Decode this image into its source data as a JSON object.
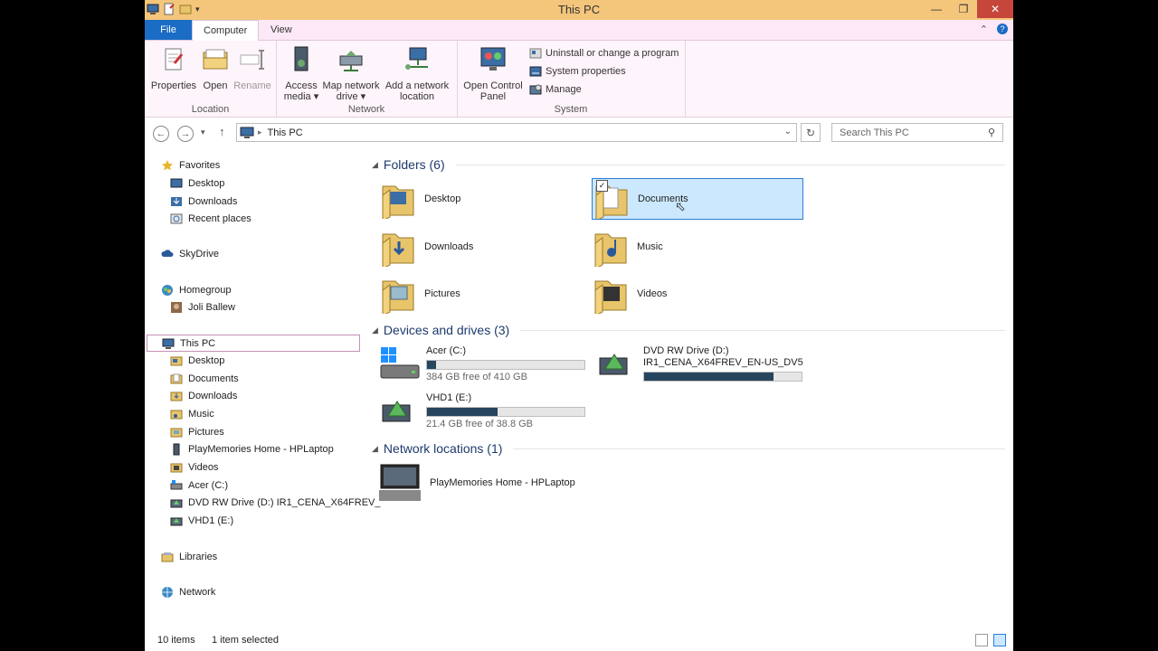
{
  "window": {
    "title": "This PC"
  },
  "ribbon": {
    "tabs": {
      "file": "File",
      "computer": "Computer",
      "view": "View"
    },
    "groups": {
      "location": "Location",
      "network": "Network",
      "system": "System"
    },
    "buttons": {
      "properties": "Properties",
      "open": "Open",
      "rename": "Rename",
      "access_media": "Access media ▾",
      "map_network_drive": "Map network drive ▾",
      "add_network_location": "Add a network location",
      "open_control_panel": "Open Control Panel",
      "uninstall": "Uninstall or change a program",
      "system_properties": "System properties",
      "manage": "Manage"
    }
  },
  "address": {
    "path": "This PC",
    "search_placeholder": "Search This PC"
  },
  "nav": {
    "favorites": "Favorites",
    "desktop": "Desktop",
    "downloads": "Downloads",
    "recent_places": "Recent places",
    "skydrive": "SkyDrive",
    "homegroup": "Homegroup",
    "joli_ballew": "Joli Ballew",
    "this_pc": "This PC",
    "pc_desktop": "Desktop",
    "pc_documents": "Documents",
    "pc_downloads": "Downloads",
    "pc_music": "Music",
    "pc_pictures": "Pictures",
    "pc_playmemories": "PlayMemories Home - HPLaptop",
    "pc_videos": "Videos",
    "pc_acer": "Acer (C:)",
    "pc_dvd": "DVD RW Drive (D:) IR1_CENA_X64FREV_",
    "pc_vhd1": "VHD1 (E:)",
    "libraries": "Libraries",
    "network": "Network"
  },
  "content": {
    "folders_header": "Folders (6)",
    "folders": {
      "desktop": "Desktop",
      "documents": "Documents",
      "downloads": "Downloads",
      "music": "Music",
      "pictures": "Pictures",
      "videos": "Videos"
    },
    "devices_header": "Devices and drives (3)",
    "drives": {
      "acer": {
        "name": "Acer (C:)",
        "free": "384 GB free of 410 GB",
        "used_fraction": 0.06
      },
      "dvd": {
        "name": "DVD RW Drive (D:)",
        "label": "IR1_CENA_X64FREV_EN-US_DV5",
        "used_fraction": 0.82
      },
      "vhd1": {
        "name": "VHD1 (E:)",
        "free": "21.4 GB free of 38.8 GB",
        "used_fraction": 0.45
      }
    },
    "network_header": "Network locations (1)",
    "network_items": {
      "playmemories": "PlayMemories Home - HPLaptop"
    }
  },
  "status": {
    "count": "10 items",
    "selected": "1 item selected"
  },
  "colors": {
    "titlebar": "#f4c67c",
    "ribbon": "#fef4fb",
    "file_tab": "#1b6cc5",
    "selection": "#cce8ff",
    "drive_bar": "#26455e"
  }
}
